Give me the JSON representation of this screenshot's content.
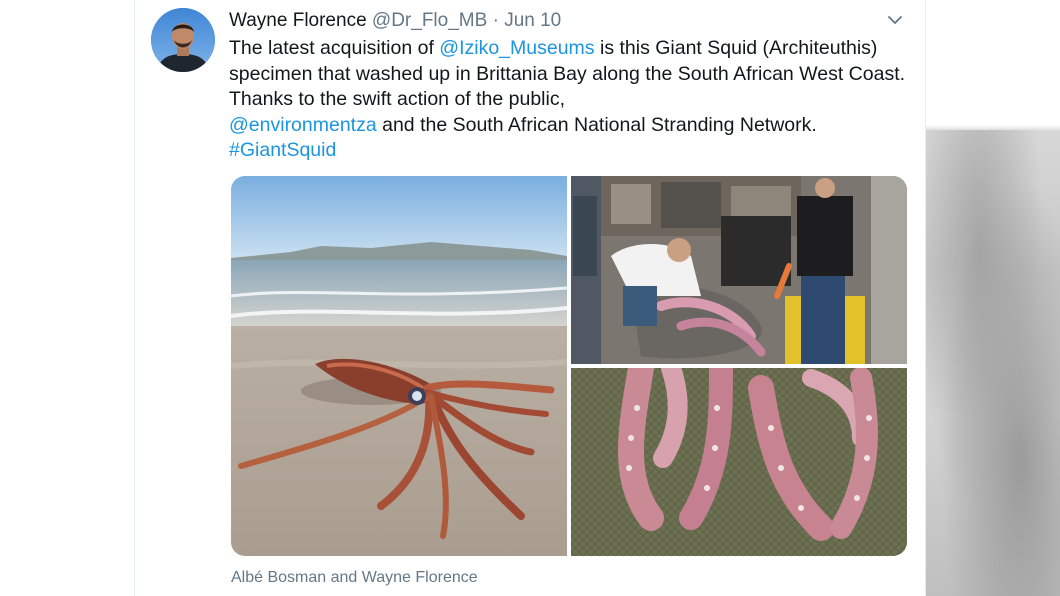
{
  "tweet": {
    "author_name": "Wayne Florence",
    "handle": "@Dr_Flo_MB",
    "separator": "·",
    "date": "Jun 10",
    "menu_icon": "chevron-down-icon",
    "text": {
      "part1": "The latest acquisition of ",
      "mention1": "@Iziko_Museums",
      "part2": " is this Giant Squid (Architeuthis) specimen that washed up in Brittania Bay along the South African West Coast. Thanks to the swift action of the public, ",
      "mention2": "@environmentza",
      "part3": " and the South African National Stranding Network. ",
      "hashtag": "#GiantSquid"
    },
    "media_credit": "Albé Bosman and Wayne Florence",
    "colors": {
      "link": "#1b95e0",
      "secondary_text": "#657786",
      "primary_text": "#14171a"
    }
  }
}
